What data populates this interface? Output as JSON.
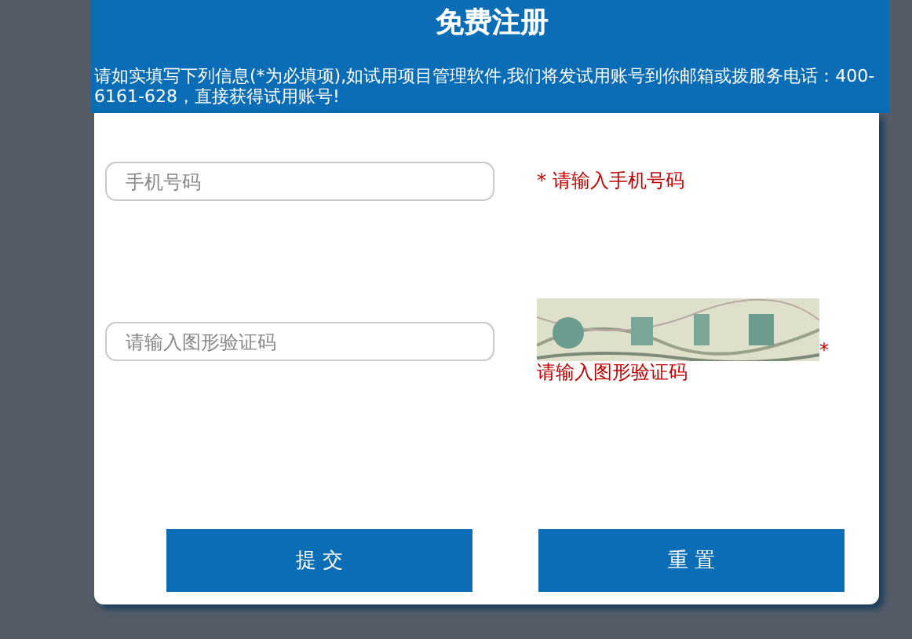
{
  "title": "免费注册",
  "intro": "请如实填写下列信息(*为必填项),如试用项目管理软件,我们将发试用账号到你邮箱或拨服务电话：400-6161-628，直接获得试用账号!",
  "fields": [
    {
      "placeholder": "手机号码",
      "hint": "* 请输入手机号码",
      "kind": "text"
    },
    {
      "placeholder": "请输入图形验证码",
      "hint": "* 请输入图形验证码",
      "kind": "captcha"
    }
  ],
  "buttons": [
    "提 交",
    "重 置"
  ]
}
